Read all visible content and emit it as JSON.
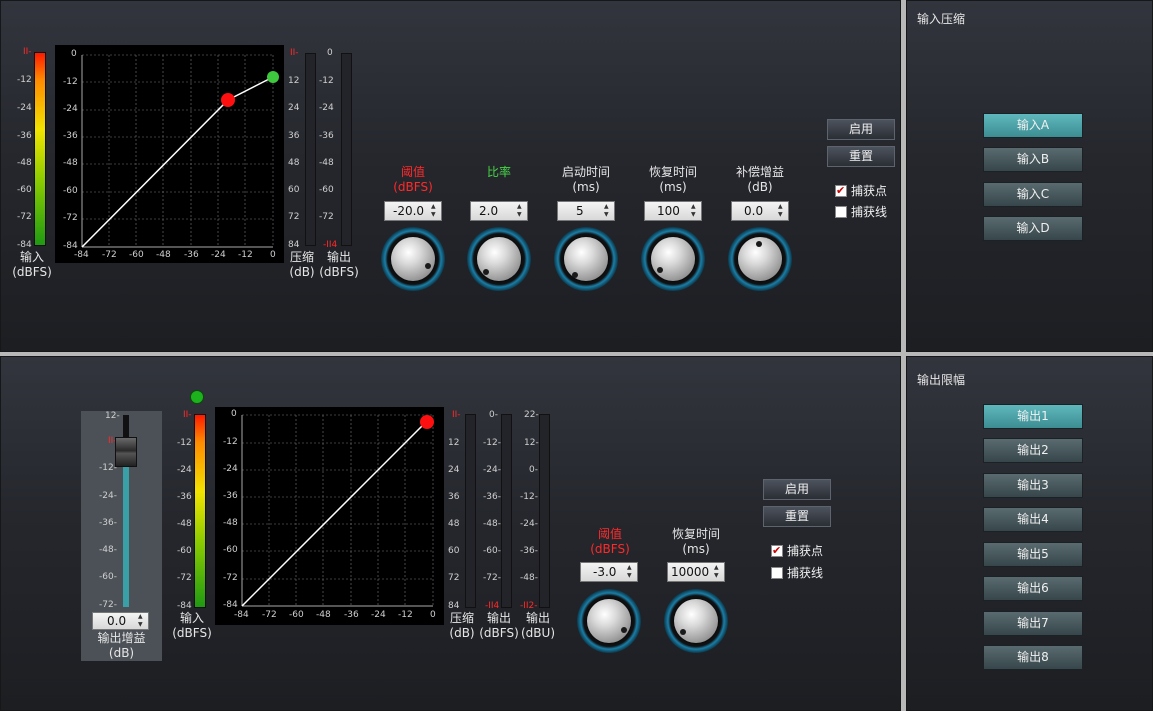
{
  "compressor": {
    "input_meter": {
      "label": "输入",
      "unit": "(dBFS)",
      "ticks": [
        "II-",
        "-12",
        "-24",
        "-36",
        "-48",
        "-60",
        "-72",
        "-84"
      ]
    },
    "graph": {
      "y_ticks": [
        "0",
        "-12",
        "-24",
        "-36",
        "-48",
        "-60",
        "-72",
        "-84"
      ],
      "x_ticks": [
        "-84",
        "-72",
        "-60",
        "-48",
        "-36",
        "-24",
        "-12",
        "0"
      ]
    },
    "comp_meter": {
      "label": "压缩",
      "unit": "(dB)",
      "ticks": [
        "II-",
        "12",
        "24",
        "36",
        "48",
        "60",
        "72",
        "84"
      ]
    },
    "output_meter": {
      "label": "输出",
      "unit": "(dBFS)",
      "ticks": [
        "0",
        "-12",
        "-24",
        "-36",
        "-48",
        "-60",
        "-72",
        "-II4"
      ]
    },
    "params": [
      {
        "name": "阈值",
        "unit": "(dBFS)",
        "value": "-20.0",
        "color": "#ff2a2a"
      },
      {
        "name": "比率",
        "unit": "",
        "value": "2.0",
        "color": "#45d545"
      },
      {
        "name": "启动时间",
        "unit": "(ms)",
        "value": "5",
        "color": "#e6e6e6"
      },
      {
        "name": "恢复时间",
        "unit": "(ms)",
        "value": "100",
        "color": "#e6e6e6"
      },
      {
        "name": "补偿增益",
        "unit": "(dB)",
        "value": "0.0",
        "color": "#e6e6e6"
      }
    ],
    "enable_label": "启用",
    "reset_label": "重置",
    "capture_point": {
      "label": "捕获点",
      "checked": true
    },
    "capture_line": {
      "label": "捕获线",
      "checked": false
    }
  },
  "input_panel": {
    "title": "输入压缩",
    "items": [
      "输入A",
      "输入B",
      "输入C",
      "输入D"
    ],
    "active_index": 0
  },
  "limiter": {
    "gain_fader": {
      "value": "0.0",
      "label": "输出增益",
      "unit": "(dB)",
      "ticks": [
        "12-",
        "II-",
        "-12-",
        "-24-",
        "-36-",
        "-48-",
        "-60-",
        "-72-"
      ]
    },
    "input_meter": {
      "label": "输入",
      "unit": "(dBFS)",
      "ticks": [
        "II-",
        "-12",
        "-24",
        "-36",
        "-48",
        "-60",
        "-72",
        "-84"
      ]
    },
    "graph": {
      "y_ticks": [
        "0",
        "-12",
        "-24",
        "-36",
        "-48",
        "-60",
        "-72",
        "-84"
      ],
      "x_ticks": [
        "-84",
        "-72",
        "-60",
        "-48",
        "-36",
        "-24",
        "-12",
        "0"
      ]
    },
    "comp_meter": {
      "label": "压缩",
      "unit": "(dB)",
      "ticks": [
        "II-",
        "12",
        "24",
        "36",
        "48",
        "60",
        "72",
        "84"
      ]
    },
    "output_meter": {
      "label": "输出",
      "unit": "(dBFS)",
      "ticks": [
        "0-",
        "-12-",
        "-24-",
        "-36-",
        "-48-",
        "-60-",
        "-72-",
        "-II4"
      ]
    },
    "output_dbu_meter": {
      "label": "输出",
      "unit": "(dBU)",
      "ticks": [
        "22-",
        "12-",
        "0-",
        "-12-",
        "-24-",
        "-36-",
        "-48-",
        "-II2-"
      ]
    },
    "params": [
      {
        "name": "阈值",
        "unit": "(dBFS)",
        "value": "-3.0",
        "color": "#ff2a2a"
      },
      {
        "name": "恢复时间",
        "unit": "(ms)",
        "value": "10000",
        "color": "#e6e6e6"
      }
    ],
    "enable_label": "启用",
    "reset_label": "重置",
    "capture_point": {
      "label": "捕获点",
      "checked": true
    },
    "capture_line": {
      "label": "捕获线",
      "checked": false
    }
  },
  "output_panel": {
    "title": "输出限幅",
    "items": [
      "输出1",
      "输出2",
      "输出3",
      "输出4",
      "输出5",
      "输出6",
      "输出7",
      "输出8"
    ],
    "active_index": 0
  }
}
